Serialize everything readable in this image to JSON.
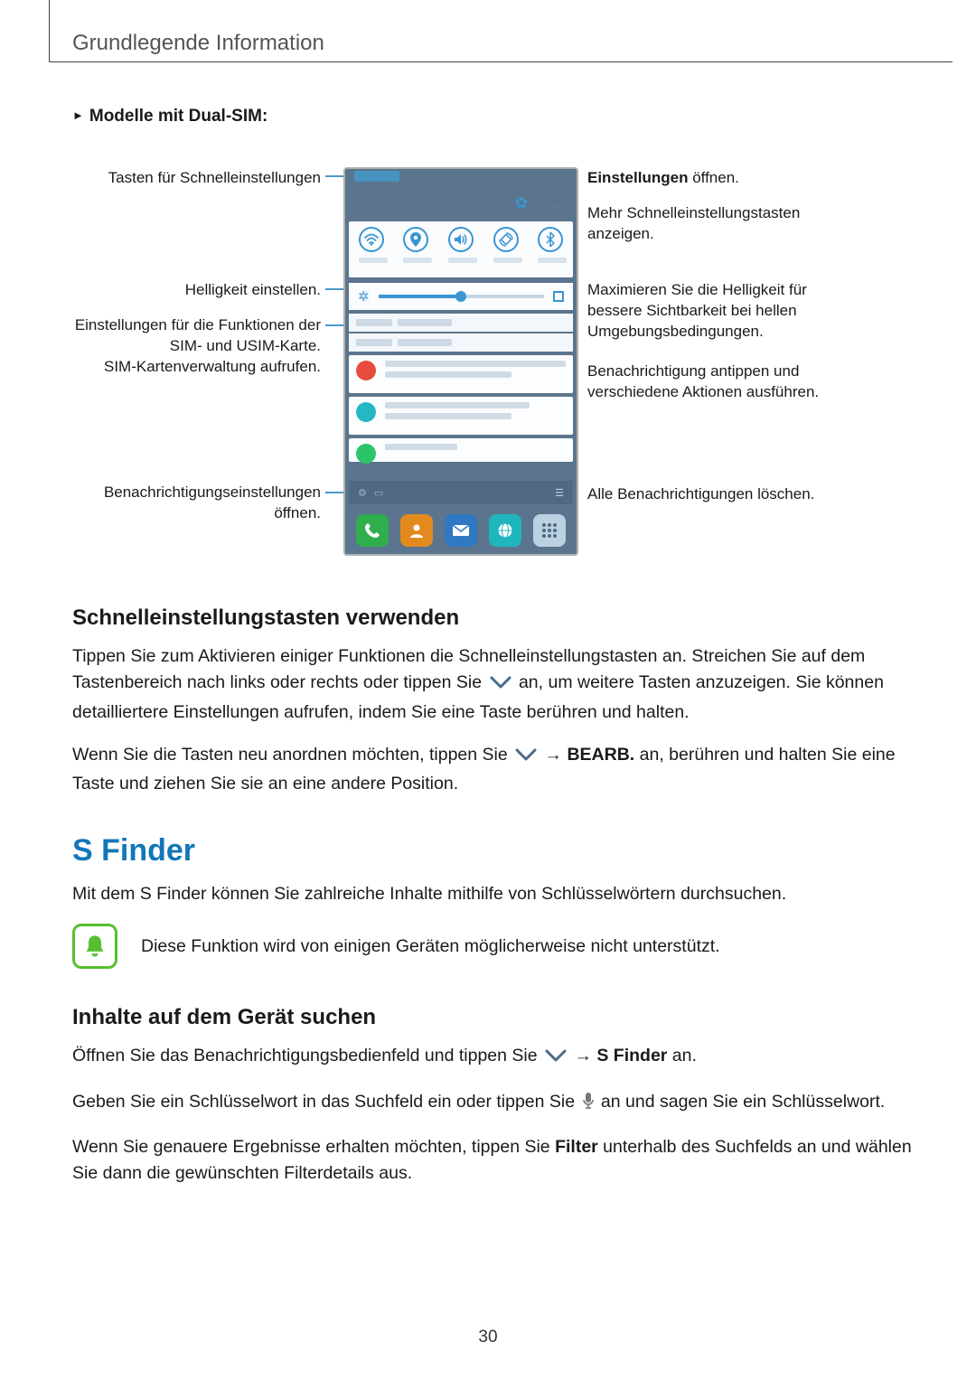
{
  "header": {
    "title": "Grundlegende Information"
  },
  "dualSim": {
    "triangle": "►",
    "label": "Modelle mit Dual-SIM",
    "colon": ":"
  },
  "callouts": {
    "left1": "Tasten für Schnelleinstellungen",
    "left2": "Helligkeit einstellen.",
    "left3a": "Einstellungen für die Funktionen der",
    "left3b": "SIM- und USIM-Karte.",
    "left3c": "SIM-Kartenverwaltung aufrufen.",
    "left4a": "Benachrichtigungseinstellungen",
    "left4b": "öffnen.",
    "right1_bold": "Einstellungen",
    "right1_rest": " öffnen.",
    "right2a": "Mehr Schnelleinstellungstasten",
    "right2b": "anzeigen.",
    "right3a": "Maximieren Sie die Helligkeit für",
    "right3b": "bessere Sichtbarkeit bei hellen",
    "right3c": "Umgebungsbedingungen.",
    "right4a": "Benachrichtigung antippen und",
    "right4b": "verschiedene Aktionen ausführen.",
    "right5": "Alle Benachrichtigungen löschen."
  },
  "sec1": {
    "heading": "Schnelleinstellungstasten verwenden",
    "p1a": "Tippen Sie zum Aktivieren einiger Funktionen die Schnelleinstellungstasten an. Streichen Sie auf dem Tastenbereich nach links oder rechts oder tippen Sie ",
    "p1b": " an, um weitere Tasten anzuzeigen. Sie können detailliertere Einstellungen aufrufen, indem Sie eine Taste berühren und halten.",
    "p2a": "Wenn Sie die Tasten neu anordnen möchten, tippen Sie ",
    "p2_arrow": " → ",
    "p2_bold": "BEARB.",
    "p2b": " an, berühren und halten Sie eine Taste und ziehen Sie sie an eine andere Position."
  },
  "sfinder": {
    "heading": "S Finder",
    "intro": "Mit dem S Finder können Sie zahlreiche Inhalte mithilfe von Schlüsselwörtern durchsuchen.",
    "note": "Diese Funktion wird von einigen Geräten möglicherweise nicht unterstützt."
  },
  "sec2": {
    "heading": "Inhalte auf dem Gerät suchen",
    "p1a": "Öffnen Sie das Benachrichtigungsbedienfeld und tippen Sie ",
    "p1_arrow": " → ",
    "p1_bold": "S Finder",
    "p1b": " an.",
    "p2a": "Geben Sie ein Schlüsselwort in das Suchfeld ein oder tippen Sie ",
    "p2b": " an und sagen Sie ein Schlüsselwort.",
    "p3a": "Wenn Sie genauere Ergebnisse erhalten möchten, tippen Sie ",
    "p3_bold": "Filter",
    "p3b": " unterhalb des Suchfelds an und wählen Sie dann die gewünschten Filterdetails aus."
  },
  "pageNumber": "30"
}
